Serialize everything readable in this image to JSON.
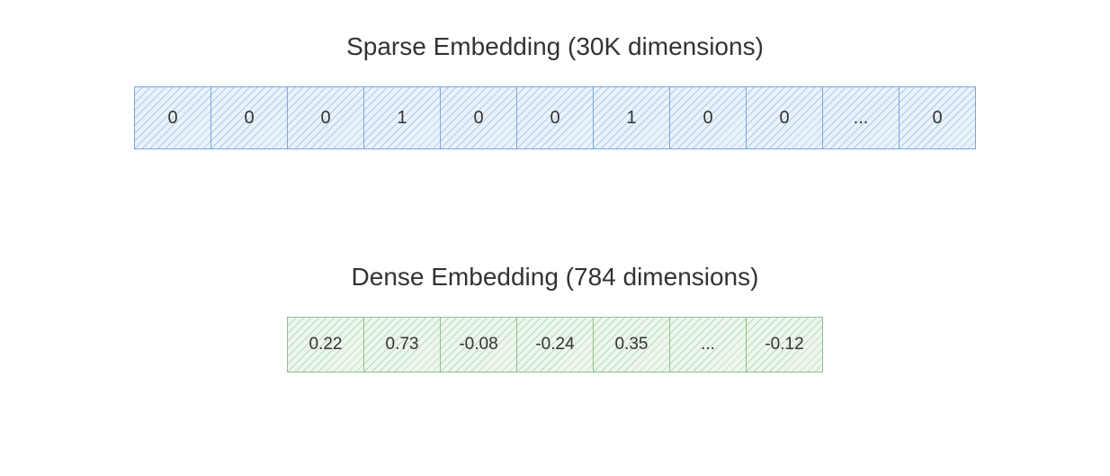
{
  "sparse": {
    "title": "Sparse Embedding (30K dimensions)",
    "cells": [
      "0",
      "0",
      "0",
      "1",
      "0",
      "0",
      "1",
      "0",
      "0",
      "...",
      "0"
    ]
  },
  "dense": {
    "title": "Dense Embedding (784 dimensions)",
    "cells": [
      "0.22",
      "0.73",
      "-0.08",
      "-0.24",
      "0.35",
      "...",
      "-0.12"
    ]
  }
}
